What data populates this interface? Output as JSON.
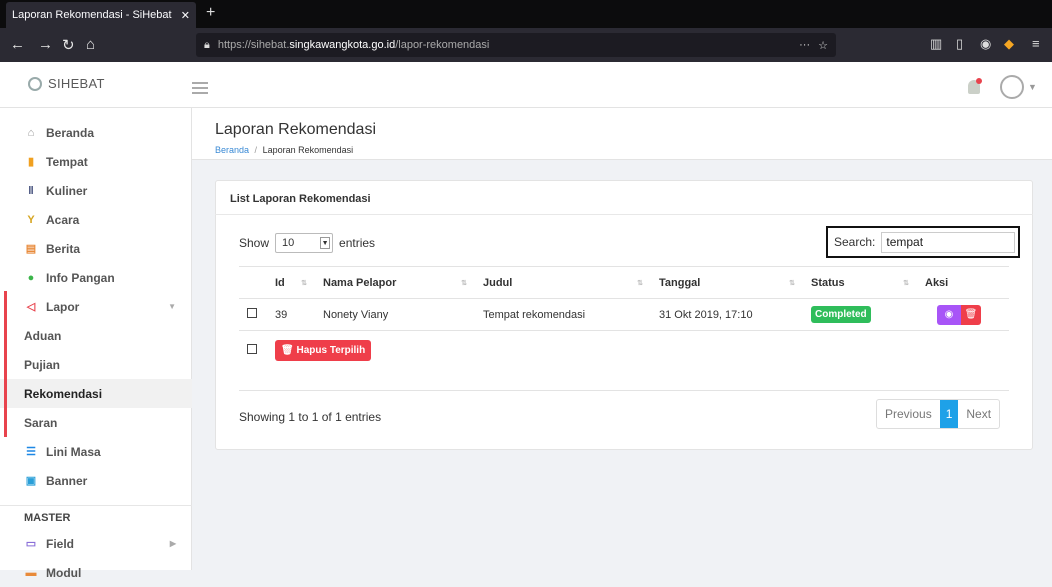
{
  "browser": {
    "tab_title": "Laporan Rekomendasi - SiHebat",
    "url_prefix": "https://sihebat.",
    "url_domain": "singkawangkota.go.id",
    "url_path": "/lapor-rekomendasi"
  },
  "app": {
    "name": "SIHEBAT"
  },
  "sidebar": {
    "items": [
      {
        "label": "Beranda",
        "icon": "home-icon"
      },
      {
        "label": "Tempat",
        "icon": "map-icon"
      },
      {
        "label": "Kuliner",
        "icon": "food-icon"
      },
      {
        "label": "Acara",
        "icon": "event-icon"
      },
      {
        "label": "Berita",
        "icon": "news-icon"
      },
      {
        "label": "Info Pangan",
        "icon": "leaf-icon"
      },
      {
        "label": "Lapor",
        "icon": "megaphone-icon"
      }
    ],
    "lapor_sub": [
      "Aduan",
      "Pujian",
      "Rekomendasi",
      "Saran"
    ],
    "after": [
      {
        "label": "Lini Masa",
        "icon": "list-icon"
      },
      {
        "label": "Banner",
        "icon": "image-icon"
      }
    ],
    "section_master": "MASTER",
    "master_items": [
      {
        "label": "Field",
        "icon": "field-icon"
      },
      {
        "label": "Modul",
        "icon": "module-icon"
      }
    ]
  },
  "page": {
    "title": "Laporan Rekomendasi",
    "crumb_home": "Beranda",
    "crumb_sep": "/",
    "crumb_current": "Laporan Rekomendasi"
  },
  "card": {
    "title": "List Laporan Rekomendasi",
    "show_label": "Show",
    "page_length": "10",
    "entries_label": "entries",
    "search_label": "Search:",
    "search_value": "tempat",
    "headers": [
      "Id",
      "Nama Pelapor",
      "Judul",
      "Tanggal",
      "Status",
      "Aksi"
    ],
    "rows": [
      {
        "id": "39",
        "nama": "Nonety Viany",
        "judul": "Tempat rekomendasi",
        "tanggal": "31 Okt 2019, 17:10",
        "status": "Completed"
      }
    ],
    "bulk_delete": "Hapus Terpilih",
    "info": "Showing 1 to 1 of 1 entries",
    "pager": {
      "prev": "Previous",
      "current": "1",
      "next": "Next"
    }
  },
  "colors": {
    "accent": "#1ea1e8",
    "danger": "#ef3e4a",
    "success": "#2fbd5b",
    "view": "#a855f7"
  }
}
